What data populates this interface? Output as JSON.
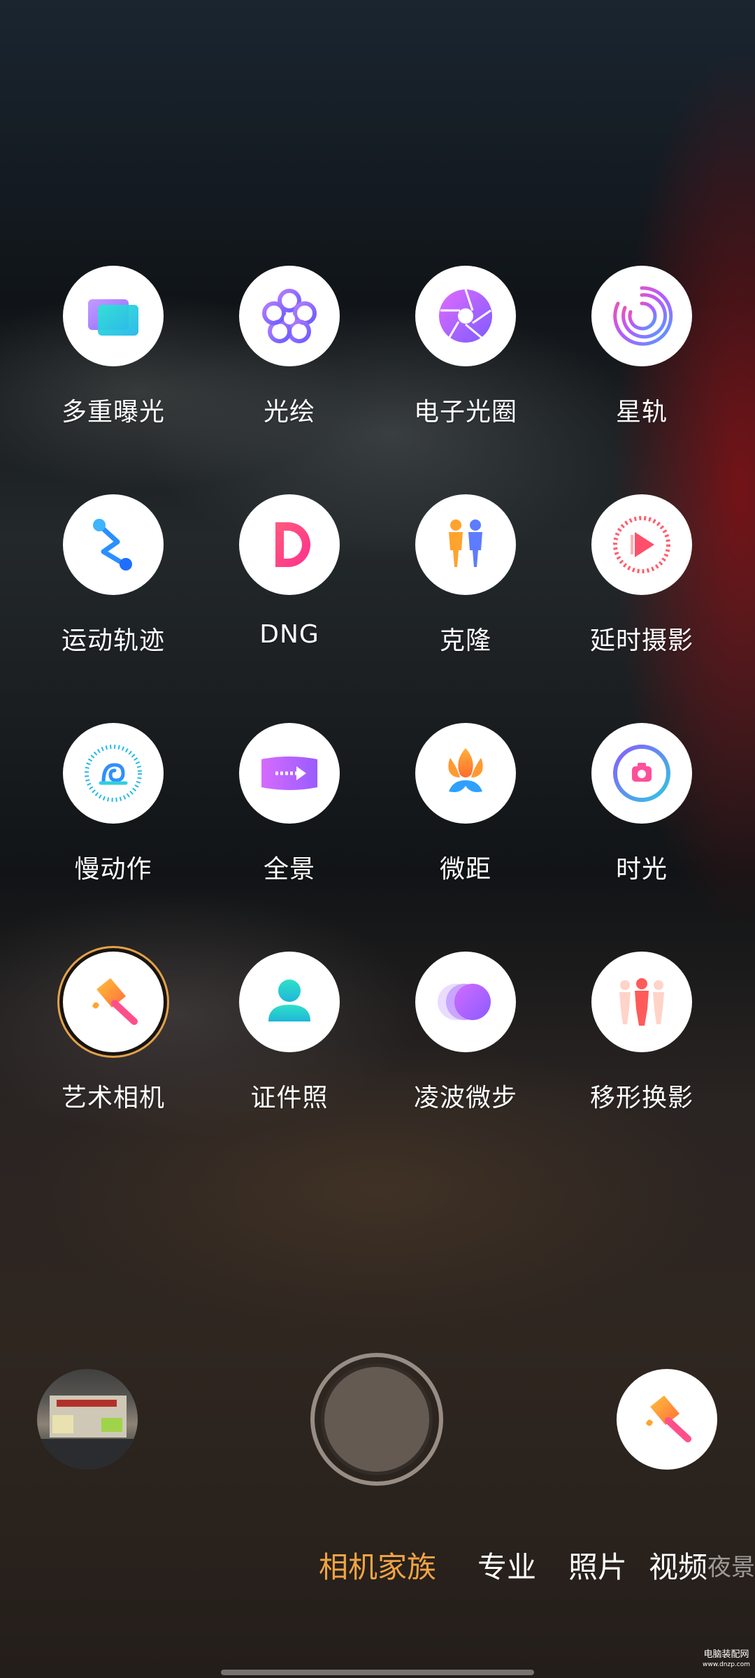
{
  "modes": [
    {
      "label": "多重曝光",
      "icon": "multi-exposure-icon"
    },
    {
      "label": "光绘",
      "icon": "light-painting-icon"
    },
    {
      "label": "电子光圈",
      "icon": "aperture-icon"
    },
    {
      "label": "星轨",
      "icon": "star-trail-icon"
    },
    {
      "label": "运动轨迹",
      "icon": "motion-trail-icon"
    },
    {
      "label": "DNG",
      "icon": "dng-icon"
    },
    {
      "label": "克隆",
      "icon": "clone-icon"
    },
    {
      "label": "延时摄影",
      "icon": "timelapse-icon"
    },
    {
      "label": "慢动作",
      "icon": "slow-motion-icon"
    },
    {
      "label": "全景",
      "icon": "panorama-icon"
    },
    {
      "label": "微距",
      "icon": "macro-icon"
    },
    {
      "label": "时光",
      "icon": "time-camera-icon"
    },
    {
      "label": "艺术相机",
      "icon": "art-camera-icon",
      "selected": true
    },
    {
      "label": "证件照",
      "icon": "id-photo-icon"
    },
    {
      "label": "凌波微步",
      "icon": "ghost-step-icon"
    },
    {
      "label": "移形换影",
      "icon": "shadow-shift-icon"
    }
  ],
  "bottom": {
    "gallery_icon": "gallery-thumbnail",
    "shutter_icon": "shutter-button",
    "current_mode_icon": "art-camera-icon"
  },
  "tabs": [
    "相机家族",
    "专业",
    "照片",
    "视频",
    "夜景"
  ],
  "active_tab": "相机家族",
  "watermark": {
    "line1": "电脑装配网",
    "line2": "www.dnzp.com"
  },
  "colors": {
    "accent": "#f0a443",
    "selected_ring": "#e3a24a"
  }
}
